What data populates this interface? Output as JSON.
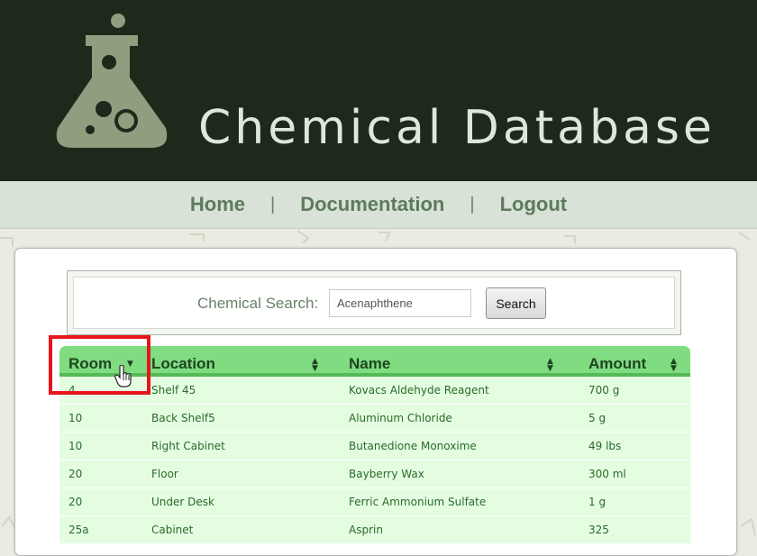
{
  "header": {
    "title": "Chemical Database",
    "logo_icon": "flask-icon"
  },
  "nav": {
    "items": [
      {
        "label": "Home"
      },
      {
        "label": "Documentation"
      },
      {
        "label": "Logout"
      }
    ],
    "separator": "|"
  },
  "search": {
    "label": "Chemical Search:",
    "input_value": "Acenaphthene",
    "button_label": "Search"
  },
  "table": {
    "columns": [
      {
        "label": "Room",
        "sort_icon": "sort-down-icon"
      },
      {
        "label": "Location",
        "sort_icon": "sort-both-icon"
      },
      {
        "label": "Name",
        "sort_icon": "sort-both-icon"
      },
      {
        "label": "Amount",
        "sort_icon": "sort-both-icon"
      }
    ],
    "rows": [
      [
        "4",
        "Shelf 45",
        "Kovacs Aldehyde Reagent",
        "700 g"
      ],
      [
        "10",
        "Back Shelf5",
        "Aluminum Chloride",
        "5 g"
      ],
      [
        "10",
        "Right Cabinet",
        "Butanedione Monoxime",
        "49 lbs"
      ],
      [
        "20",
        "Floor",
        "Bayberry Wax",
        "300 ml"
      ],
      [
        "20",
        "Under Desk",
        "Ferric Ammonium Sulfate",
        "1 g"
      ],
      [
        "25a",
        "Cabinet",
        "Asprin",
        "325"
      ]
    ]
  },
  "colors": {
    "header_bg": "#1e291c",
    "nav_text": "#5e7a5c",
    "table_header": "#7fdc80",
    "row_bg": "#e4fde1",
    "highlight": "#e8141c"
  }
}
